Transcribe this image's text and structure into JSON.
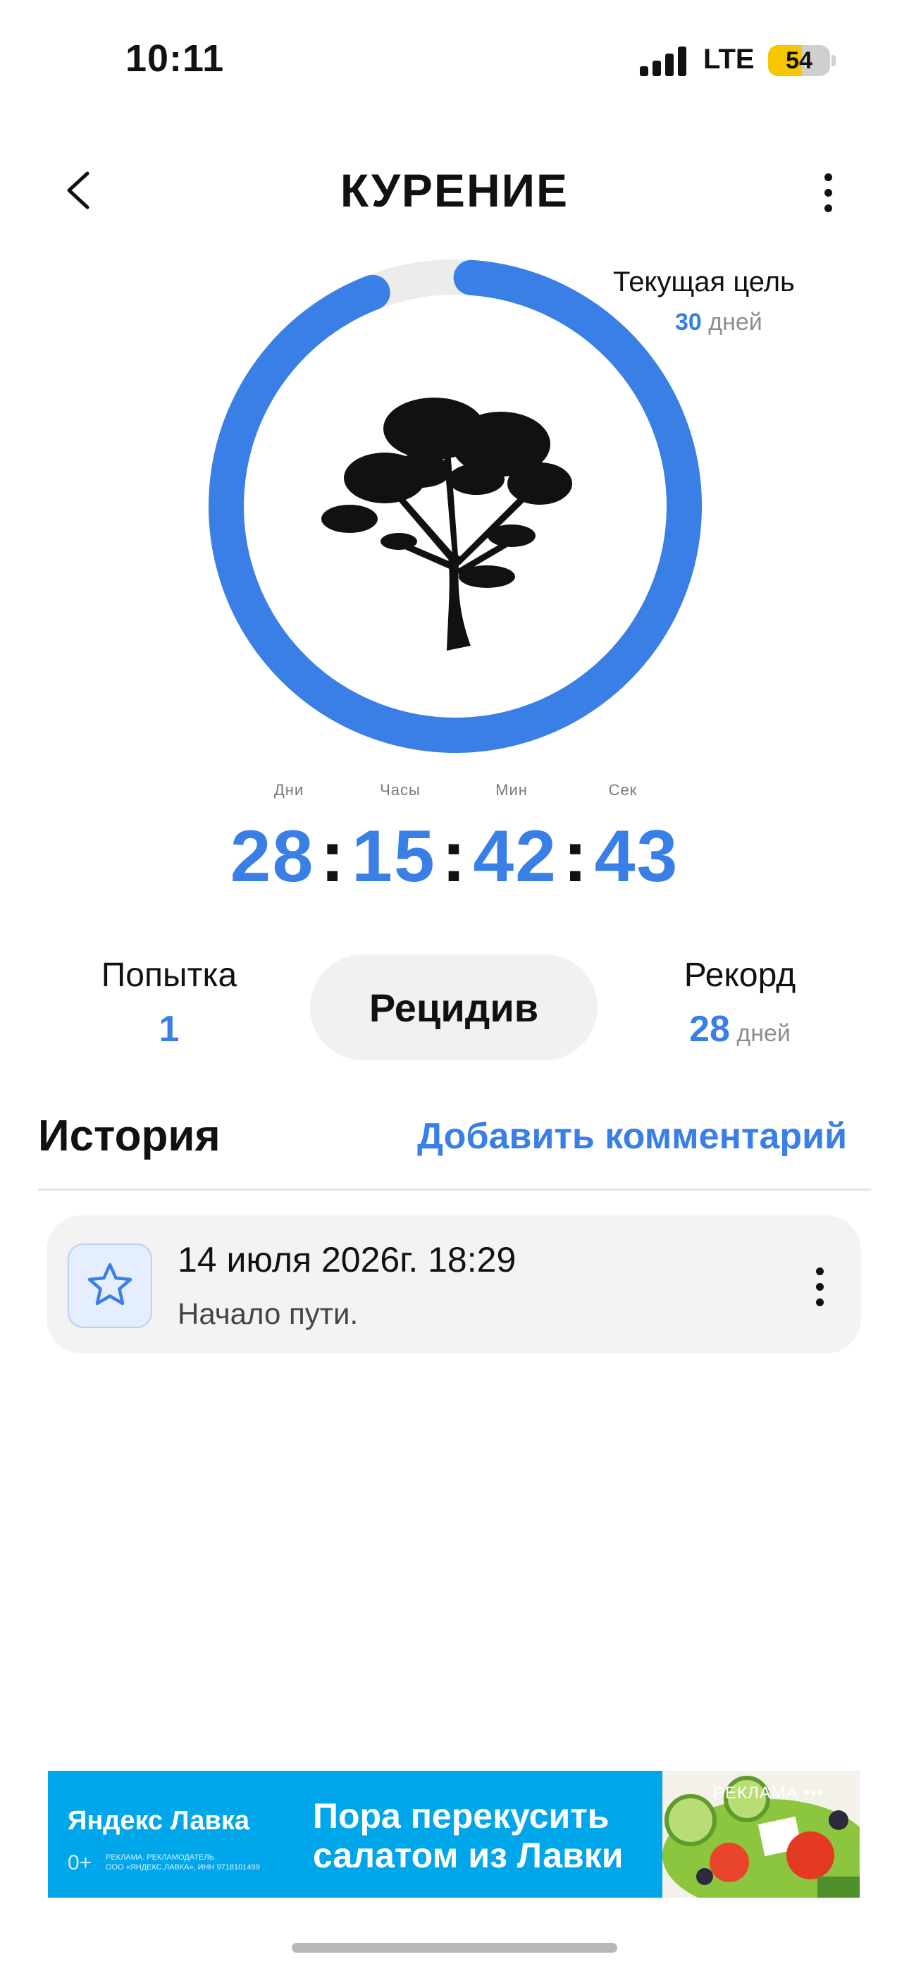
{
  "status_bar": {
    "time": "10:11",
    "network": "LTE",
    "battery": "54"
  },
  "header": {
    "title": "КУРЕНИЕ",
    "back_icon": "chevron-left-icon",
    "menu_icon": "more-vertical-icon"
  },
  "goal": {
    "label": "Текущая цель",
    "value": "30",
    "unit": "дней"
  },
  "progress": {
    "fraction": 0.93,
    "color": "#3a7fe6",
    "track_color": "#ececec",
    "image": "tree-silhouette"
  },
  "timer": {
    "units": [
      "Дни",
      "Часы",
      "Мин",
      "Сек"
    ],
    "days": "28",
    "hours": "15",
    "minutes": "42",
    "seconds": "43",
    "separator": ":"
  },
  "stats": {
    "attempt_label": "Попытка",
    "attempt_value": "1",
    "relapse_button": "Рецидив",
    "record_label": "Рекорд",
    "record_value": "28",
    "record_unit": "дней"
  },
  "history": {
    "title": "История",
    "add_comment": "Добавить комментарий",
    "entries": [
      {
        "date": "14 июля 2026г. 18:29",
        "text": "Начало пути.",
        "icon": "star-icon"
      }
    ]
  },
  "ad": {
    "brand": "Яндекс Лавка",
    "age": "0+",
    "disclaimer_1": "РЕКЛАМА. РЕКЛАМОДАТЕЛЬ",
    "disclaimer_2": "ООО «ЯНДЕКС.ЛАВКА», ИНН 9718101499",
    "headline_1": "Пора перекусить",
    "headline_2": "салатом из Лавки",
    "tag": "РЕКЛАМА •••"
  },
  "colors": {
    "accent": "#3a7fe6",
    "ad_background": "#00a6ea"
  }
}
